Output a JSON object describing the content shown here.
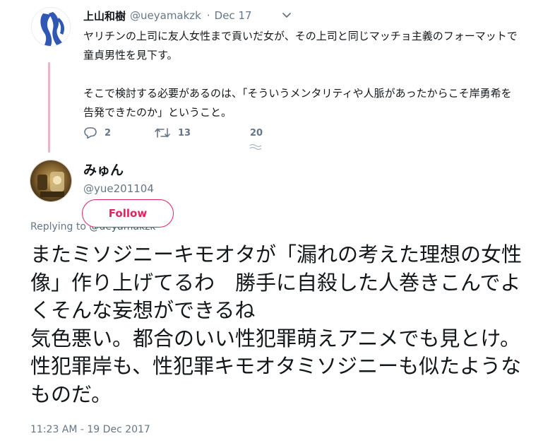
{
  "parent_tweet": {
    "display_name": "上山和樹",
    "handle": "@ueyamakzk",
    "separator": "·",
    "date": "Dec 17",
    "text": "ヤリチンの上司に友人女性まで貢いだ女が、その上司と同じマッチョ主義のフォーマットで童貞男性を見下す。\n\nそこで検討する必要があるのは、「そういうメンタリティや人脈があったからこそ岸勇希を告発できたのか」ということ。",
    "replies": "2",
    "retweets": "13",
    "likes": "20"
  },
  "main_tweet": {
    "display_name": "みゅん",
    "handle": "@yue201104",
    "follow_label": "Follow",
    "replying_prefix": "Replying to",
    "replying_handle": "@ueyamakzk",
    "text": "またミソジニーキモオタが「漏れの考えた理想の女性像」作り上げてるわ　勝手に自殺した人巻きこんでよくそんな妄想ができるね\n気色悪い。都合のいい性犯罪萌えアニメでも見とけ。性犯罪岸も、性犯罪キモオタミソジニーも似たようなものだ。",
    "timestamp": "11:23 AM - 19 Dec 2017"
  },
  "colors": {
    "accent": "#e0245e",
    "thread_line": "#e8b6c6",
    "secondary_text": "#657786",
    "primary_text": "#14171a"
  },
  "icons": {
    "reply": "reply-icon",
    "retweet": "retweet-icon",
    "caret": "chevron-down-icon"
  }
}
